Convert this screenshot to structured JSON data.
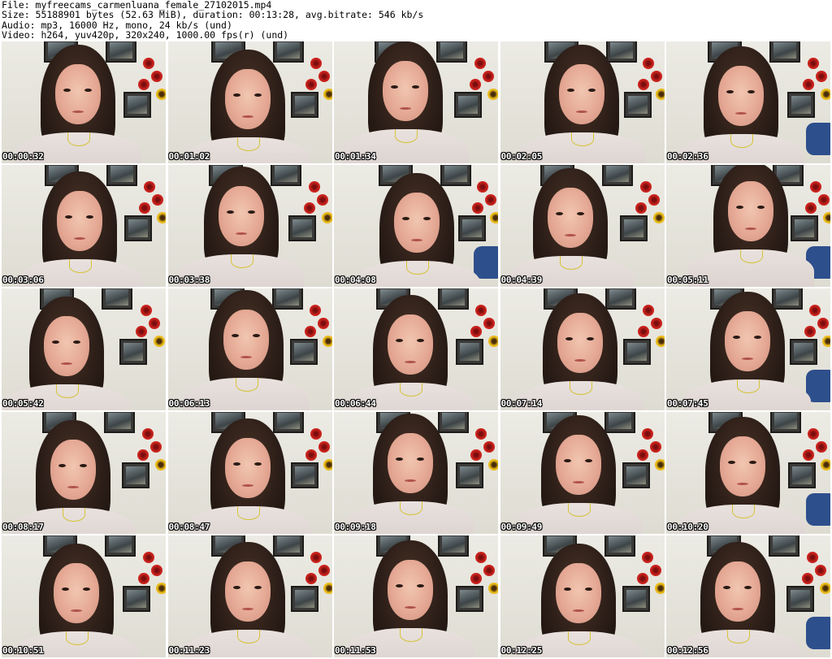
{
  "header": {
    "file_line": "File: myfreecams_carmenluana_female_27102015.mp4",
    "size_line": "Size: 55188901 bytes (52.63 MiB), duration: 00:13:28, avg.bitrate: 546 kb/s",
    "audio_line": "Audio: mp3, 16000 Hz, mono, 24 kb/s (und)",
    "video_line": "Video: h264, yuv420p, 320x240, 1000.00 fps(r) (und)"
  },
  "thumbnails": [
    {
      "timestamp": "00:00:32"
    },
    {
      "timestamp": "00:01:02"
    },
    {
      "timestamp": "00:01:34"
    },
    {
      "timestamp": "00:02:05"
    },
    {
      "timestamp": "00:02:36"
    },
    {
      "timestamp": "00:03:06"
    },
    {
      "timestamp": "00:03:38"
    },
    {
      "timestamp": "00:04:08"
    },
    {
      "timestamp": "00:04:39"
    },
    {
      "timestamp": "00:05:11"
    },
    {
      "timestamp": "00:05:42"
    },
    {
      "timestamp": "00:06:13"
    },
    {
      "timestamp": "00:06:44"
    },
    {
      "timestamp": "00:07:14"
    },
    {
      "timestamp": "00:07:45"
    },
    {
      "timestamp": "00:08:17"
    },
    {
      "timestamp": "00:08:47"
    },
    {
      "timestamp": "00:09:18"
    },
    {
      "timestamp": "00:09:49"
    },
    {
      "timestamp": "00:10:20"
    },
    {
      "timestamp": "00:10:51"
    },
    {
      "timestamp": "00:11:23"
    },
    {
      "timestamp": "00:11:53"
    },
    {
      "timestamp": "00:12:25"
    },
    {
      "timestamp": "00:12:56"
    }
  ]
}
